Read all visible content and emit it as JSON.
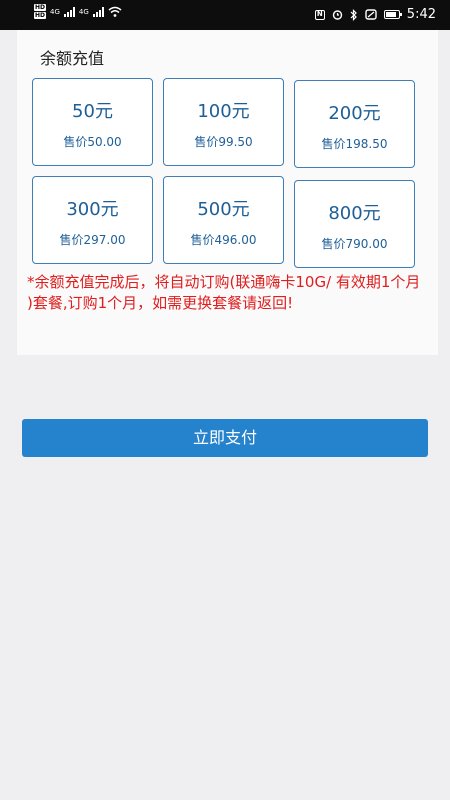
{
  "status_bar": {
    "hd_badge_1": "HD",
    "hd_badge_2": "HD",
    "network_1": "4G",
    "network_2": "4G",
    "nfc_label": "N",
    "time": "5:42"
  },
  "page": {
    "section_title": "余额充值",
    "packages": [
      {
        "amount": "50元",
        "price": "售价50.00"
      },
      {
        "amount": "100元",
        "price": "售价99.50"
      },
      {
        "amount": "200元",
        "price": "售价198.50"
      },
      {
        "amount": "300元",
        "price": "售价297.00"
      },
      {
        "amount": "500元",
        "price": "售价496.00"
      },
      {
        "amount": "800元",
        "price": "售价790.00"
      }
    ],
    "notice": "*余额充值完成后，将自动订购(联通嗨卡10G/ 有效期1个月 )套餐,订购1个月，如需更换套餐请返回!",
    "pay_button": "立即支付"
  },
  "colors": {
    "accent": "#2582cc",
    "tile_border": "#3d7eb6",
    "tile_text": "#1e5f97",
    "notice": "#e01e1e"
  },
  "icons": [
    "signal-icon",
    "wifi-icon",
    "nfc-icon",
    "alarm-icon",
    "bluetooth-icon",
    "mute-icon",
    "battery-icon"
  ]
}
